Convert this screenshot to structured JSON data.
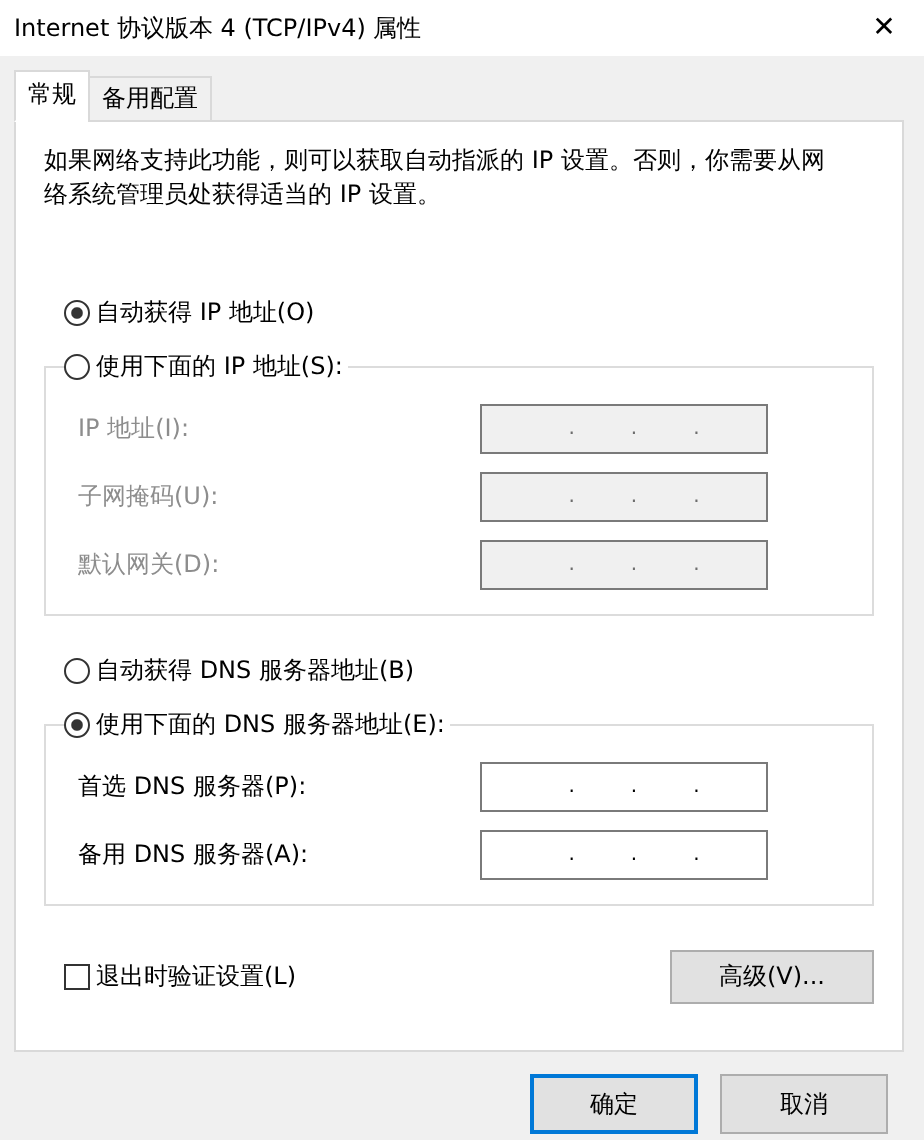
{
  "window": {
    "title": "Internet 协议版本 4 (TCP/IPv4) 属性",
    "close": "✕"
  },
  "tabs": [
    {
      "label": "常规",
      "selected": true
    },
    {
      "label": "备用配置",
      "selected": false
    }
  ],
  "description": "如果网络支持此功能，则可以获取自动指派的 IP 设置。否则，你需要从网络系统管理员处获得适当的 IP 设置。",
  "sections": [
    {
      "auto": {
        "label": "自动获得 IP 地址(O)",
        "selected": true
      },
      "manual": {
        "label": "使用下面的 IP 地址(S):",
        "selected": false
      },
      "fields": [
        {
          "label": "IP 地址(I):",
          "disabled": true,
          "separators": [
            ".",
            ".",
            "."
          ]
        },
        {
          "label": "子网掩码(U):",
          "disabled": true,
          "separators": [
            ".",
            ".",
            "."
          ]
        },
        {
          "label": "默认网关(D):",
          "disabled": true,
          "separators": [
            ".",
            ".",
            "."
          ]
        }
      ]
    },
    {
      "auto": {
        "label": "自动获得 DNS 服务器地址(B)",
        "selected": false
      },
      "manual": {
        "label": "使用下面的 DNS 服务器地址(E):",
        "selected": true
      },
      "fields": [
        {
          "label": "首选 DNS 服务器(P):",
          "disabled": false,
          "separators": [
            ".",
            ".",
            "."
          ]
        },
        {
          "label": "备用 DNS 服务器(A):",
          "disabled": false,
          "separators": [
            ".",
            ".",
            "."
          ]
        }
      ]
    }
  ],
  "validate": {
    "label": "退出时验证设置(L)",
    "checked": false
  },
  "advanced_button": "高级(V)...",
  "buttons": [
    {
      "label": "确定",
      "default": true
    },
    {
      "label": "取消",
      "default": false
    }
  ]
}
